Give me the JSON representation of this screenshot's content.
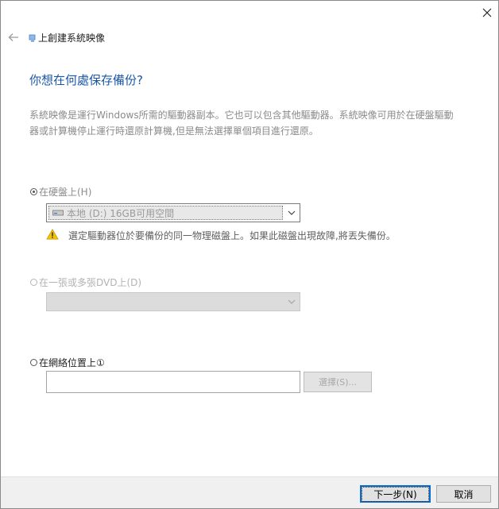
{
  "wizard": {
    "title": "上創建系統映像",
    "heading": "你想在何處保存備份?",
    "description": "系統映像是運行Windows所需的驅動器副本。它也可以包含其他驅動器。系統映像可用於在硬盤驅動器或計算機停止運行時還原計算機,但是無法選擇單個項目進行還原。"
  },
  "options": {
    "hard_disk": {
      "label": "在硬盤上(H)",
      "selected": true,
      "drive_value": "本地 (D:) 16GB可用空間",
      "warning": "選定驅動器位於要備份的同一物理磁盤上。如果此磁盤出現故障,將丟失備份。"
    },
    "dvd": {
      "label": "在一張或多張DVD上(D)",
      "selected": false,
      "drive_value": ""
    },
    "network": {
      "label": "在網絡位置上①",
      "selected": false,
      "path_value": "",
      "browse_label": "選擇(S)..."
    }
  },
  "footer": {
    "next_label": "下一步(N)",
    "cancel_label": "取消"
  },
  "colors": {
    "heading": "#1a56a8",
    "accent_border": "#0a6cd2",
    "warning": "#f3c300"
  },
  "icons": {
    "close": "close-icon",
    "back": "back-arrow-icon",
    "wizard": "system-image-icon",
    "drive": "hard-drive-icon",
    "warning": "warning-icon",
    "dropdown": "chevron-down-icon"
  }
}
